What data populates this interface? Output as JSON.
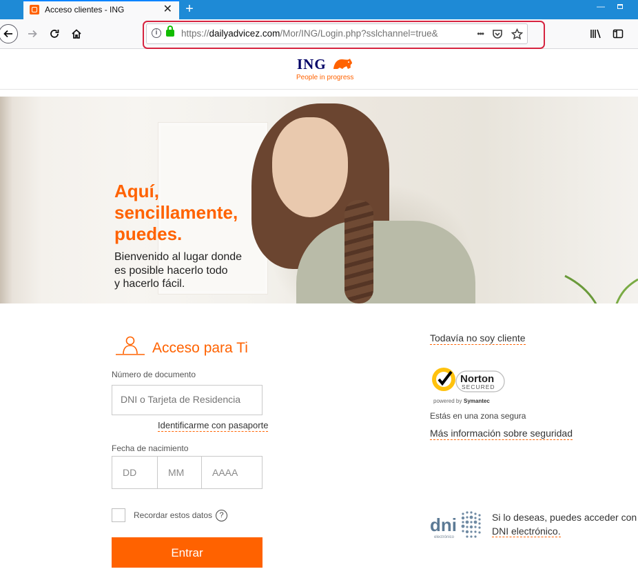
{
  "browser": {
    "tab_title": "Acceso clientes - ING",
    "tab_close": "✕",
    "new_tab": "+",
    "url_prefix": "https://",
    "url_domain": "dailyadvicez.com",
    "url_path": "/Mor/ING/Login.php?sslchannel=true&",
    "url_actions": [
      "•••",
      "pocket-icon",
      "star-icon"
    ],
    "colors": {
      "tabbar": "#1e8ad6",
      "highlight": "#d6233f",
      "lock": "#12bc00"
    }
  },
  "header": {
    "logo_word": "ING",
    "tagline": "People in progress",
    "brand_color": "#ff6200",
    "logo_color": "#000066"
  },
  "hero": {
    "title_lines": [
      "Aquí,",
      "sencillamente,",
      "puedes."
    ],
    "subtitle_lines": [
      "Bienvenido al lugar donde",
      "es posible hacerlo todo",
      "y hacerlo fácil."
    ]
  },
  "login": {
    "section_title": "Acceso para Ti",
    "doc_label": "Número de documento",
    "doc_placeholder": "DNI o Tarjeta de Residencia",
    "passport_link": "Identificarme con pasaporte",
    "dob_label": "Fecha de nacimiento",
    "dob_placeholders": {
      "day": "DD",
      "month": "MM",
      "year": "AAAA"
    },
    "remember_label": "Recordar estos datos",
    "help_symbol": "?",
    "submit_label": "Entrar"
  },
  "sidebar": {
    "not_client_link": "Todavía no soy cliente",
    "norton": {
      "brand": "Norton",
      "secured": "SECURED",
      "powered": "powered by",
      "powered_brand": "Symantec"
    },
    "secure_zone_text": "Estás en una zona segura",
    "security_info_link": "Más información sobre seguridad",
    "dni": {
      "logo_word": "dni",
      "logo_sub": "electrónico",
      "text_before": "Si lo deseas, puedes acceder con",
      "link": "DNI electrónico."
    }
  }
}
